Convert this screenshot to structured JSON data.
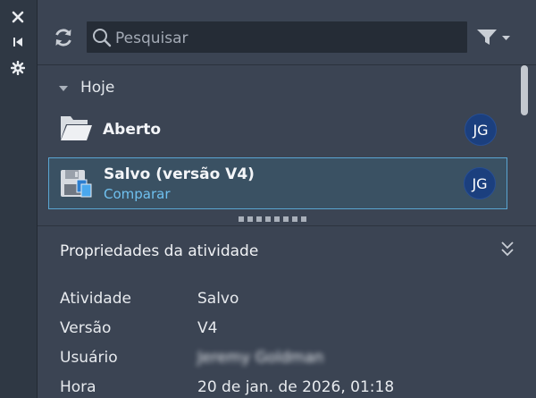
{
  "rail": {
    "close_icon": "close-icon",
    "collapse_icon": "collapse-panel-icon",
    "settings_icon": "gear-icon"
  },
  "toolbar": {
    "refresh_icon": "refresh-icon",
    "search_placeholder": "Pesquisar",
    "filter_icon": "filter-icon"
  },
  "activity_list": {
    "group_label": "Hoje",
    "items": [
      {
        "title": "Aberto",
        "subtitle": "",
        "avatar": "JG",
        "icon": "folder-open-icon",
        "selected": false
      },
      {
        "title": "Salvo (versão V4)",
        "subtitle": "Comparar",
        "avatar": "JG",
        "icon": "save-icon",
        "selected": true
      }
    ]
  },
  "properties": {
    "title": "Propriedades da atividade",
    "rows": [
      {
        "key": "Atividade",
        "value": "Salvo"
      },
      {
        "key": "Versão",
        "value": "V4"
      },
      {
        "key": "Usuário",
        "value": "Jeremy Goldman"
      },
      {
        "key": "Hora",
        "value": "20 de jan. de 2026, 01:18"
      }
    ]
  },
  "colors": {
    "panel_bg": "#3b4453",
    "selection_bg": "#3a5163",
    "selection_border": "#5aa5d2",
    "link": "#6fc0ef",
    "avatar_bg": "#1b3f7e"
  }
}
